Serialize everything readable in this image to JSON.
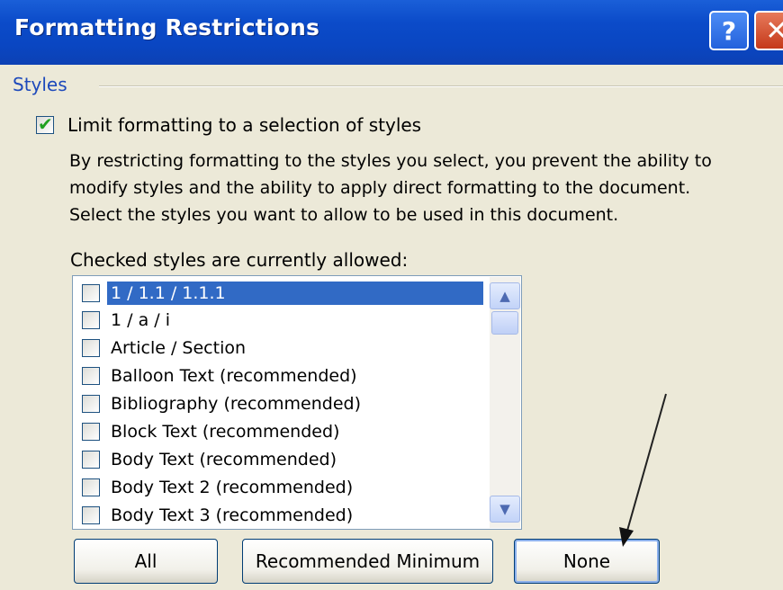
{
  "window": {
    "title": "Formatting Restrictions",
    "help_label": "?",
    "close_label": "✕"
  },
  "styles_group": {
    "label": "Styles",
    "limit_checkbox": {
      "label": "Limit formatting to a selection of styles",
      "checked": true
    },
    "description": [
      "By restricting formatting to the styles you select, you prevent the ability to",
      "modify styles and the ability to apply direct formatting to the document.",
      "Select the styles you want to allow to be used in this document."
    ],
    "allowed_label": "Checked styles are currently allowed:",
    "styles": [
      {
        "label": "1 / 1.1 / 1.1.1",
        "selected": true,
        "checked": false
      },
      {
        "label": "1 / a / i",
        "selected": false,
        "checked": false
      },
      {
        "label": "Article / Section",
        "selected": false,
        "checked": false
      },
      {
        "label": "Balloon Text (recommended)",
        "selected": false,
        "checked": false
      },
      {
        "label": "Bibliography (recommended)",
        "selected": false,
        "checked": false
      },
      {
        "label": "Block Text (recommended)",
        "selected": false,
        "checked": false
      },
      {
        "label": "Body Text (recommended)",
        "selected": false,
        "checked": false
      },
      {
        "label": "Body Text 2 (recommended)",
        "selected": false,
        "checked": false
      },
      {
        "label": "Body Text 3 (recommended)",
        "selected": false,
        "checked": false
      }
    ]
  },
  "buttons": {
    "all": "All",
    "recommended_minimum": "Recommended Minimum",
    "none": "None"
  },
  "colors": {
    "title_bar": "#0b4bc9",
    "selection": "#316ac5",
    "group_label": "#1d49bb",
    "dialog_bg": "#ece9d8"
  }
}
